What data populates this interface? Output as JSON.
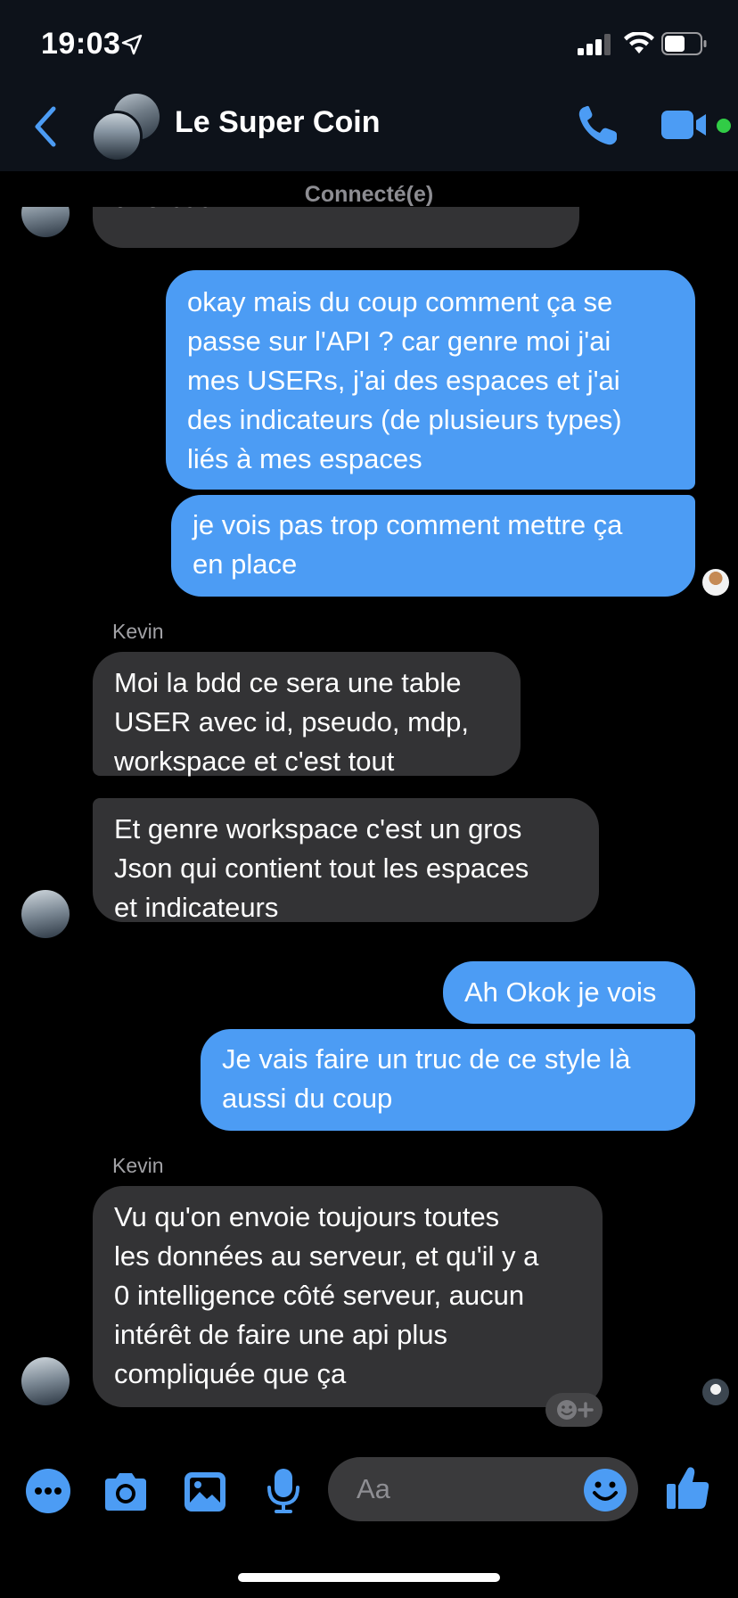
{
  "status": {
    "time": "19:03"
  },
  "header": {
    "title": "Le Super Coin",
    "subtitle": "Connecté(e)"
  },
  "messages": {
    "m0": "une bdd",
    "m1_lines": [
      "okay mais du coup comment ça se",
      "passe sur l'API ? car genre moi j'ai",
      "mes USERs, j'ai des espaces et j'ai",
      "des indicateurs (de plusieurs types)",
      "liés à mes espaces"
    ],
    "m2_lines": [
      "je vois pas trop comment mettre ça",
      "en place"
    ],
    "sender1": "Kevin",
    "m3_lines": [
      "Moi la bdd ce sera une table",
      "USER avec id, pseudo, mdp,",
      "workspace et c'est tout"
    ],
    "m4_lines": [
      "Et genre workspace c'est un gros",
      "Json qui contient tout les espaces",
      "et indicateurs"
    ],
    "m5": "Ah Okok je vois",
    "m6_lines": [
      "Je vais faire un truc de ce style là",
      "aussi du coup"
    ],
    "sender2": "Kevin",
    "m7_lines": [
      "Vu qu'on envoie toujours toutes",
      "les données au serveur, et qu'il y a",
      "0 intelligence côté serveur, aucun",
      "intérêt de faire une api plus",
      "compliquée que ça"
    ]
  },
  "composer": {
    "placeholder": "Aa"
  },
  "icons": {
    "more": "more-icon",
    "camera": "camera-icon",
    "gallery": "gallery-icon",
    "mic": "microphone-icon",
    "emoji": "emoji-icon",
    "like": "thumbs-up-icon",
    "back": "chevron-left-icon",
    "phone": "phone-icon",
    "video": "video-icon"
  },
  "colors": {
    "accent": "#4c9cf4",
    "incoming": "#333335",
    "online": "#31cc46"
  }
}
